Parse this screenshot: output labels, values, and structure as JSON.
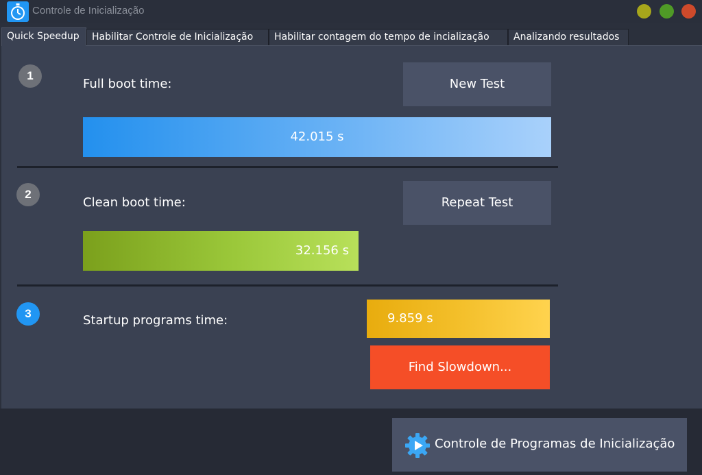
{
  "window": {
    "title": "Controle de Inicialização",
    "icon": "stopwatch-icon"
  },
  "tabs": [
    {
      "label": "Quick Speedup",
      "active": true
    },
    {
      "label": "Habilitar Controle de Inicialização",
      "active": false
    },
    {
      "label": "Habilitar contagem do tempo de incialização",
      "active": false
    },
    {
      "label": "Analizando resultados",
      "active": false
    }
  ],
  "steps": {
    "full": {
      "number": "1",
      "label": "Full boot time:",
      "button": "New Test",
      "value": "42.015 s"
    },
    "clean": {
      "number": "2",
      "label": "Clean boot time:",
      "button": "Repeat Test",
      "value": "32.156 s"
    },
    "startup": {
      "number": "3",
      "label": "Startup programs time:",
      "value": "9.859 s",
      "button": "Find Slowdown..."
    }
  },
  "footer": {
    "button": "Controle de Programas de Inicialização",
    "icon": "gear-play-icon"
  },
  "colors": {
    "accent_blue": "#2196f3",
    "full_bar": "#2390ee",
    "clean_bar": "#9bc83a",
    "startup_bar": "#f3bf2a",
    "slowdown_button": "#f54e27"
  }
}
